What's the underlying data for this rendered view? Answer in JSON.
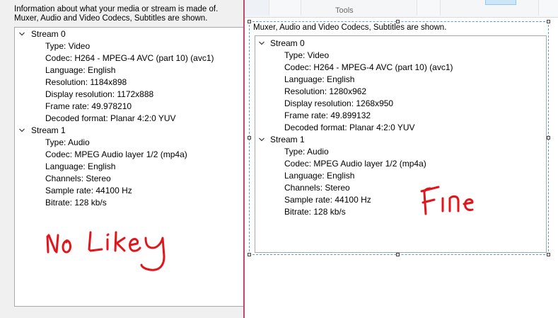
{
  "left": {
    "info_line1": "Information about what your media or stream is made of.",
    "info_line2": "Muxer, Audio and Video Codecs, Subtitles are shown.",
    "streams": [
      {
        "title": "Stream 0",
        "props": [
          "Type: Video",
          "Codec: H264 - MPEG-4 AVC (part 10) (avc1)",
          "Language: English",
          "Resolution: 1184x898",
          "Display resolution: 1172x888",
          "Frame rate: 49.978210",
          "Decoded format: Planar 4:2:0 YUV"
        ]
      },
      {
        "title": "Stream 1",
        "props": [
          "Type: Audio",
          "Codec: MPEG Audio layer 1/2 (mp4a)",
          "Language: English",
          "Channels: Stereo",
          "Sample rate: 44100 Hz",
          "Bitrate: 128 kb/s"
        ]
      }
    ],
    "handwriting": "No Likey"
  },
  "right": {
    "ribbon_label": "Tools",
    "info_line": "Muxer, Audio and Video Codecs, Subtitles are shown.",
    "streams": [
      {
        "title": "Stream 0",
        "props": [
          "Type: Video",
          "Codec: H264 - MPEG-4 AVC (part 10) (avc1)",
          "Language: English",
          "Resolution: 1280x962",
          "Display resolution: 1268x950",
          "Frame rate: 49.899132",
          "Decoded format: Planar 4:2:0 YUV"
        ]
      },
      {
        "title": "Stream 1",
        "props": [
          "Type: Audio",
          "Codec: MPEG Audio layer 1/2 (mp4a)",
          "Language: English",
          "Channels: Stereo",
          "Sample rate: 44100 Hz",
          "Bitrate: 128 kb/s"
        ]
      }
    ],
    "handwriting": "Fine"
  },
  "colors": {
    "annotation": "#e0161c",
    "divider": "#c0486c",
    "selection": "#5b9bd5"
  }
}
